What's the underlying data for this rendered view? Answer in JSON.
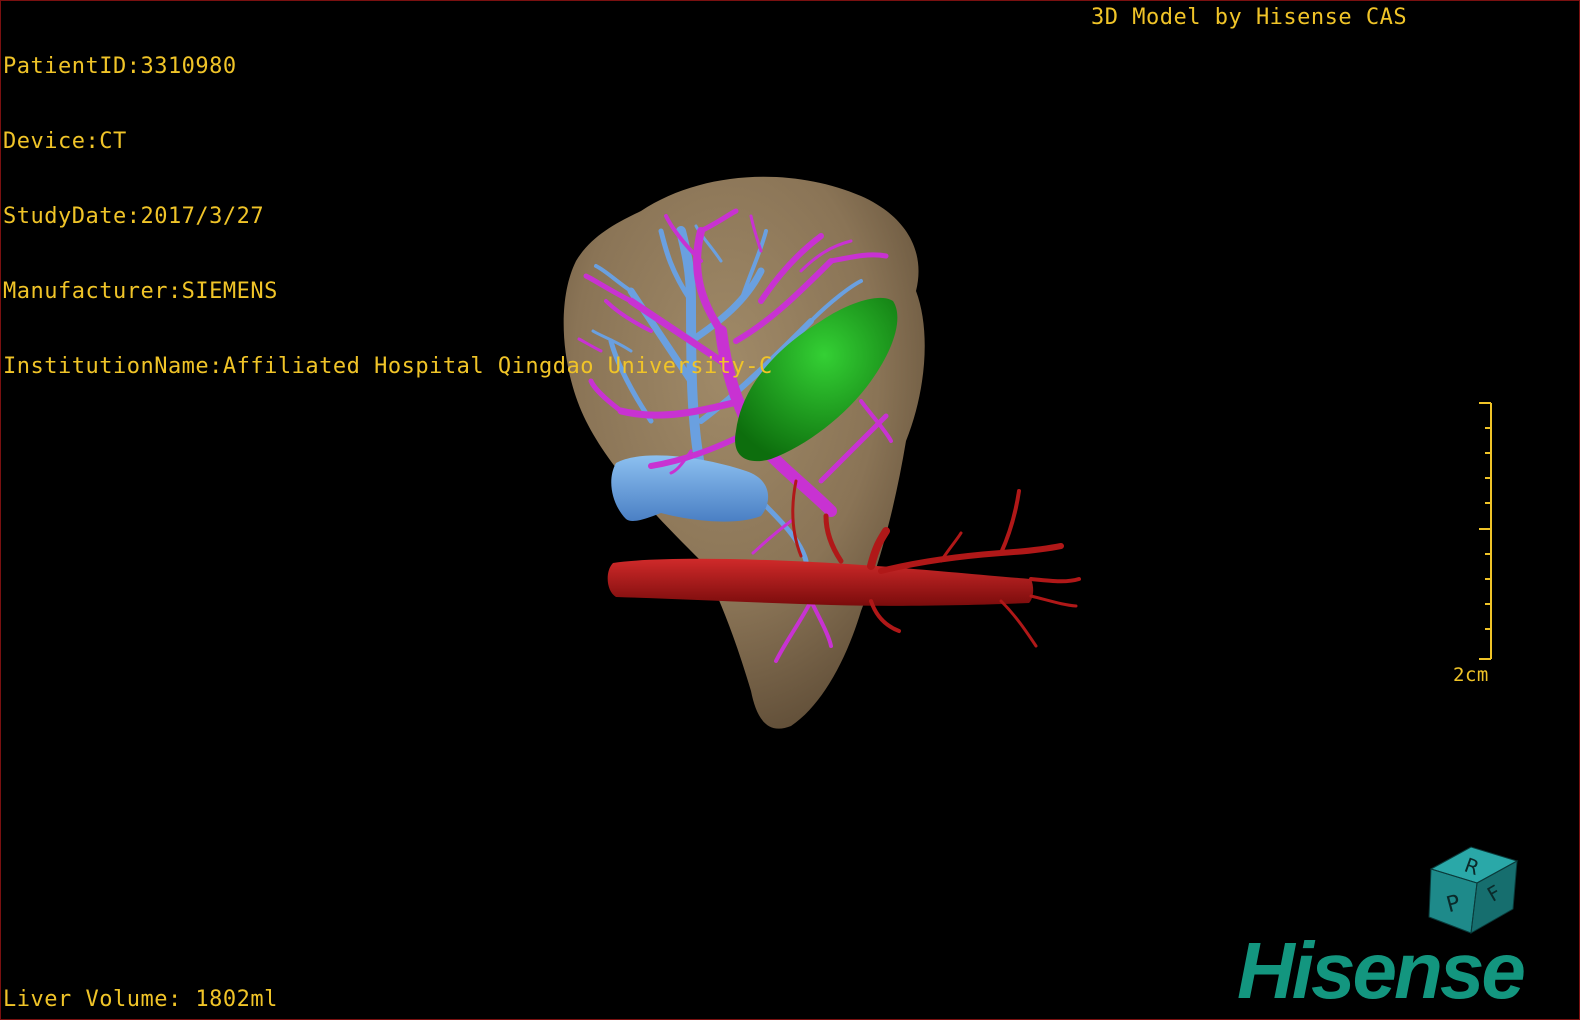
{
  "overlay": {
    "patient_id": "PatientID:3310980",
    "device": "Device:CT",
    "study_date": "StudyDate:2017/3/27",
    "manufacturer": "Manufacturer:SIEMENS",
    "institution": "InstitutionName:Affiliated Hospital Qingdao University-C",
    "model_title": "3D Model by Hisense CAS",
    "liver_volume": "Liver Volume: 1802ml"
  },
  "scale": {
    "label": "2cm"
  },
  "orientation_cube": {
    "faces": {
      "top": "R",
      "front": "P",
      "side": "F"
    },
    "color": "#1e8a8a"
  },
  "brand": {
    "logo": "Hisense",
    "color": "#13967f"
  },
  "colors": {
    "overlay_text": "#f0c428",
    "liver": "#8a7456",
    "portal_vein": "#c832d2",
    "hepatic_vein": "#6aa0e0",
    "gallbladder": "#1fa51f",
    "artery": "#b01818"
  }
}
